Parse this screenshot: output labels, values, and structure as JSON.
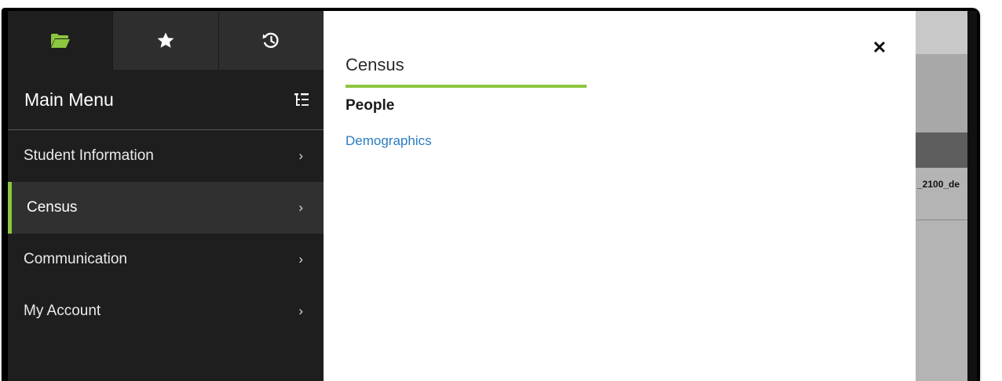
{
  "sidebar": {
    "tabs": [
      {
        "icon": "folder-open-icon",
        "active": true
      },
      {
        "icon": "star-icon",
        "active": false
      },
      {
        "icon": "history-icon",
        "active": false
      }
    ],
    "title": "Main Menu",
    "collapse_icon": "tree-list-icon",
    "items": [
      {
        "label": "Student Information",
        "active": false
      },
      {
        "label": "Census",
        "active": true
      },
      {
        "label": "Communication",
        "active": false
      },
      {
        "label": "My Account",
        "active": false
      }
    ],
    "chevron": "›"
  },
  "panel": {
    "title": "Census",
    "close": "✕",
    "section": "People",
    "links": [
      "Demographics"
    ]
  },
  "background": {
    "cell_text": "_2100_de"
  },
  "colors": {
    "accent": "#8dc63f",
    "link": "#2a7bc0",
    "sidebar_bg": "#1e1e1e"
  }
}
